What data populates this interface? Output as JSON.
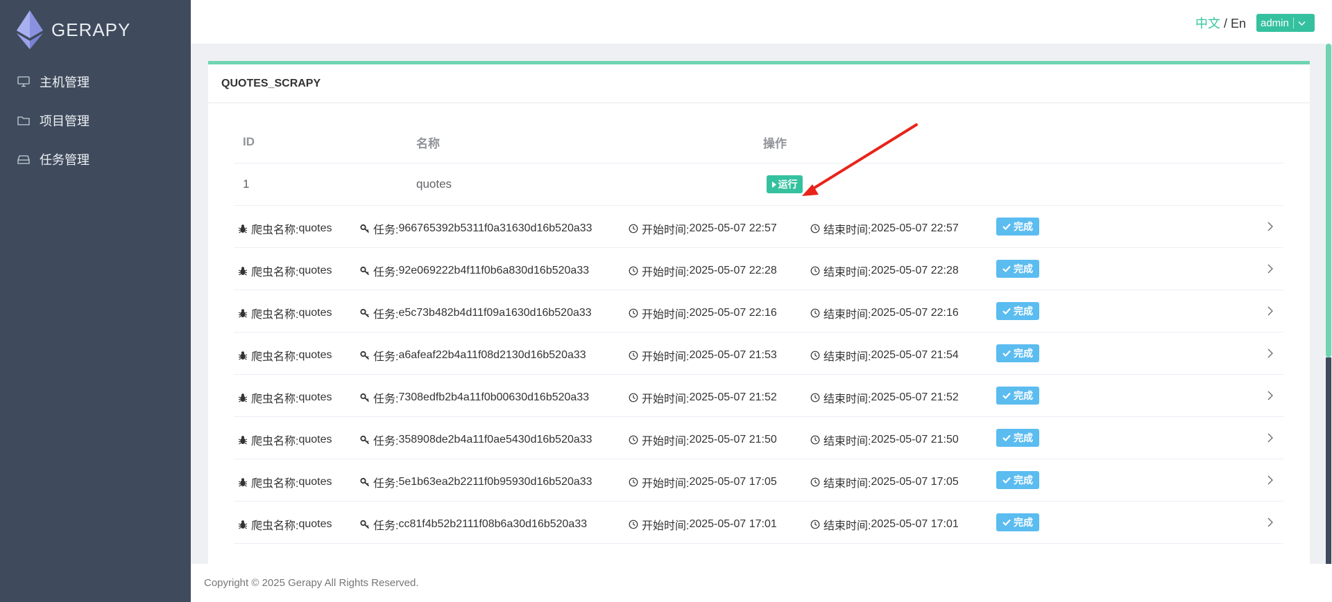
{
  "app": {
    "brand": "GERAPY"
  },
  "sidebar": {
    "items": [
      {
        "label": "主机管理",
        "icon": "monitor-icon"
      },
      {
        "label": "项目管理",
        "icon": "folder-icon"
      },
      {
        "label": "任务管理",
        "icon": "inbox-icon"
      }
    ]
  },
  "header": {
    "lang_zh": "中文",
    "lang_sep": " / ",
    "lang_en": "En",
    "user": "admin"
  },
  "card": {
    "title": "QUOTES_SCRAPY",
    "columns": {
      "id": "ID",
      "name": "名称",
      "op": "操作"
    },
    "project": {
      "id": "1",
      "name": "quotes",
      "run_label": "运行"
    }
  },
  "tasks": {
    "spider_label": "爬虫名称: ",
    "job_label": "任务: ",
    "start_label": "开始时间: ",
    "end_label": "结束时间: ",
    "rows": [
      {
        "spider": "quotes",
        "job": "966765392b5311f0a31630d16b520a33",
        "start": "2025-05-07 22:57",
        "end": "2025-05-07 22:57",
        "status": "完成"
      },
      {
        "spider": "quotes",
        "job": "92e069222b4f11f0b6a830d16b520a33",
        "start": "2025-05-07 22:28",
        "end": "2025-05-07 22:28",
        "status": "完成"
      },
      {
        "spider": "quotes",
        "job": "e5c73b482b4d11f09a1630d16b520a33",
        "start": "2025-05-07 22:16",
        "end": "2025-05-07 22:16",
        "status": "完成"
      },
      {
        "spider": "quotes",
        "job": "a6afeaf22b4a11f08d2130d16b520a33",
        "start": "2025-05-07 21:53",
        "end": "2025-05-07 21:54",
        "status": "完成"
      },
      {
        "spider": "quotes",
        "job": "7308edfb2b4a11f0b00630d16b520a33",
        "start": "2025-05-07 21:52",
        "end": "2025-05-07 21:52",
        "status": "完成"
      },
      {
        "spider": "quotes",
        "job": "358908de2b4a11f0ae5430d16b520a33",
        "start": "2025-05-07 21:50",
        "end": "2025-05-07 21:50",
        "status": "完成"
      },
      {
        "spider": "quotes",
        "job": "5e1b63ea2b2211f0b95930d16b520a33",
        "start": "2025-05-07 17:05",
        "end": "2025-05-07 17:05",
        "status": "完成"
      },
      {
        "spider": "quotes",
        "job": "cc81f4b52b2111f08b6a30d16b520a33",
        "start": "2025-05-07 17:01",
        "end": "2025-05-07 17:01",
        "status": "完成"
      }
    ]
  },
  "footer": {
    "copyright": "Copyright © 2025 Gerapy All Rights Reserved."
  },
  "colors": {
    "sidebar": "#3f4b5c",
    "accent": "#35c19f",
    "status": "#5bbcf0",
    "annotation": "#e8241b"
  }
}
